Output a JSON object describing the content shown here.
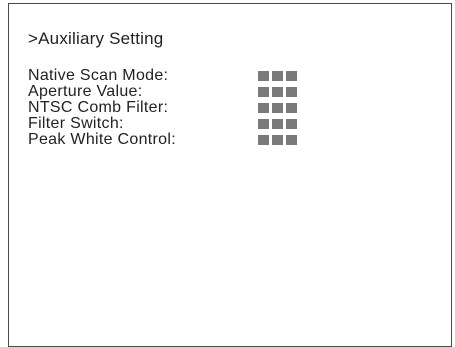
{
  "menu": {
    "title": ">Auxiliary Setting",
    "items": [
      {
        "label": "Native Scan Mode:",
        "value_blocks": 3
      },
      {
        "label": "Aperture Value:",
        "value_blocks": 3
      },
      {
        "label": "NTSC Comb Filter:",
        "value_blocks": 3
      },
      {
        "label": "Filter Switch:",
        "value_blocks": 3
      },
      {
        "label": "Peak White Control:",
        "value_blocks": 3
      }
    ]
  },
  "colors": {
    "frame": "#4a4a4a",
    "text": "#222222",
    "value_placeholder": "#7a7a7a"
  }
}
